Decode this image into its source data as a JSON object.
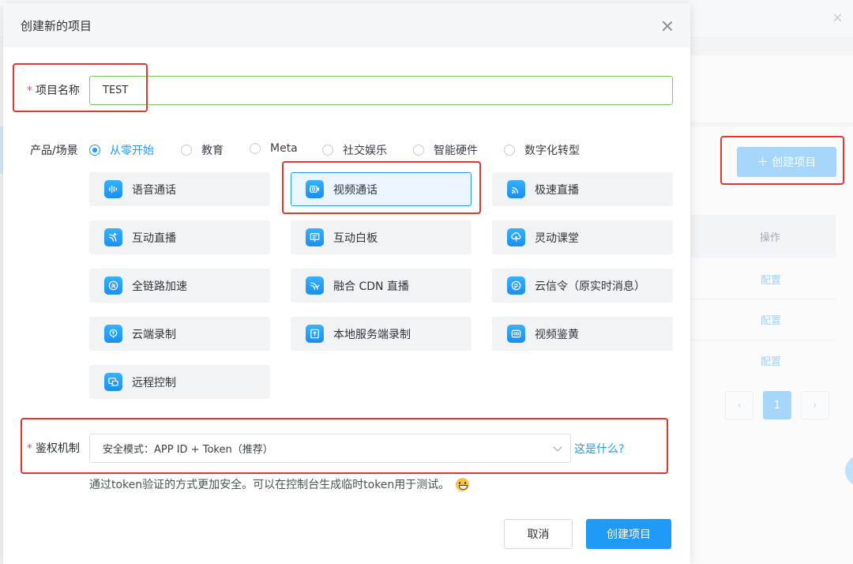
{
  "background": {
    "create_button_label": "＋ 创建项目",
    "table_header_action": "操作",
    "row_links": [
      "配置",
      "配置",
      "配置"
    ],
    "pagination": {
      "prev": "‹",
      "current": "1",
      "next": "›"
    },
    "close_glyph": "×"
  },
  "dialog": {
    "title": "创建新的项目",
    "project_name": {
      "required_mark": "*",
      "label": "项目名称",
      "value": "TEST"
    },
    "product_scene": {
      "label": "产品/场景",
      "options": [
        {
          "label": "从零开始",
          "checked": true
        },
        {
          "label": "教育",
          "checked": false
        },
        {
          "label": "Meta",
          "checked": false
        },
        {
          "label": "社交娱乐",
          "checked": false
        },
        {
          "label": "智能硬件",
          "checked": false
        },
        {
          "label": "数字化转型",
          "checked": false
        }
      ]
    },
    "products": [
      {
        "label": "语音通话",
        "icon": "waveform-icon"
      },
      {
        "label": "视频通话",
        "icon": "video-camera-icon",
        "selected": true
      },
      {
        "label": "极速直播",
        "icon": "broadcast-icon"
      },
      {
        "label": "互动直播",
        "icon": "live-plus-icon"
      },
      {
        "label": "互动白板",
        "icon": "whiteboard-icon"
      },
      {
        "label": "灵动课堂",
        "icon": "classroom-icon"
      },
      {
        "label": "全链路加速",
        "icon": "accelerate-icon"
      },
      {
        "label": "融合 CDN 直播",
        "icon": "cdn-live-icon"
      },
      {
        "label": "云信令（原实时消息）",
        "icon": "message-icon"
      },
      {
        "label": "云端录制",
        "icon": "cloud-record-icon"
      },
      {
        "label": "本地服务端录制",
        "icon": "local-record-icon"
      },
      {
        "label": "视频鉴黄",
        "icon": "moderation-icon"
      },
      {
        "label": "远程控制",
        "icon": "remote-control-icon"
      }
    ],
    "auth": {
      "required_mark": "*",
      "label": "鉴权机制",
      "selected": "安全模式：APP ID + Token（推荐）",
      "help_link": "这是什么?",
      "hint": "通过token验证的方式更加安全。可以在控制台生成临时token用于测试。"
    },
    "buttons": {
      "cancel": "取消",
      "confirm": "创建项目"
    }
  },
  "colors": {
    "accent": "#1f9af7",
    "annotation_red": "#e8332a",
    "input_focus_green": "#79c966"
  }
}
